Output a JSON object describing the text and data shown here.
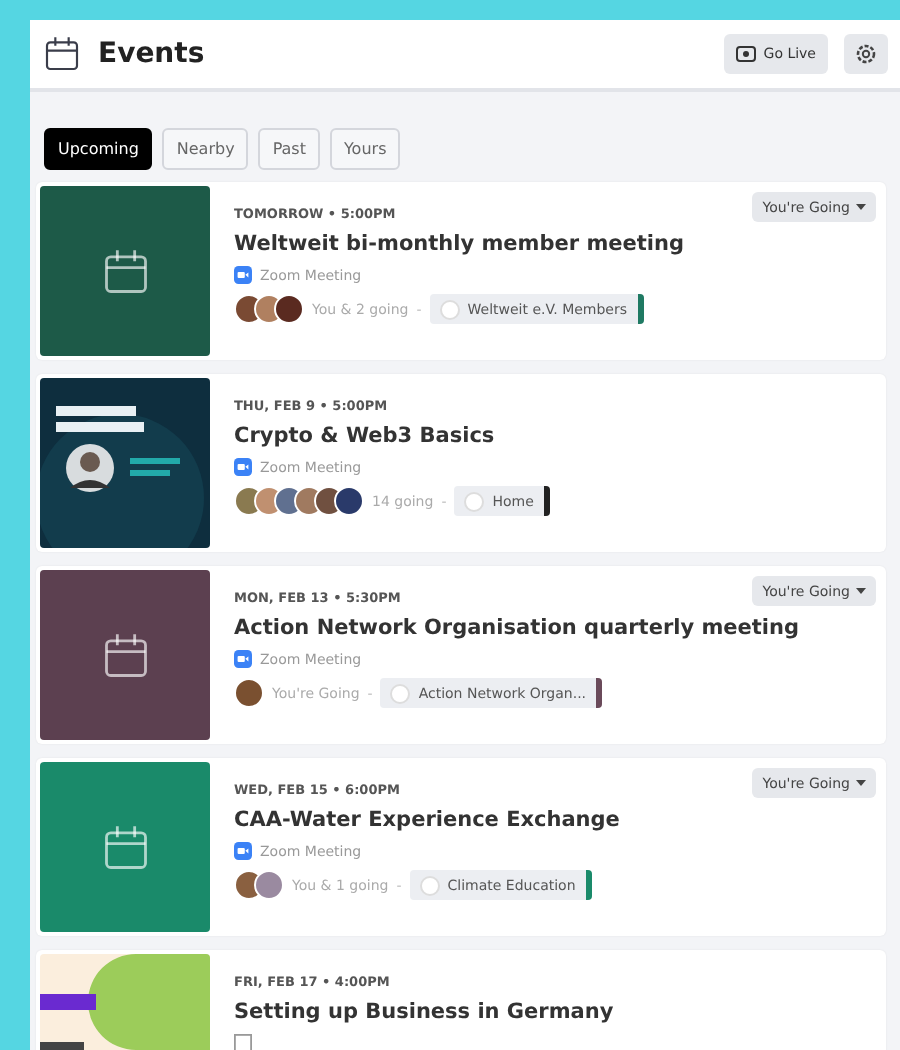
{
  "header": {
    "title": "Events",
    "go_live": "Go Live"
  },
  "tabs": [
    {
      "label": "Upcoming",
      "selected": true
    },
    {
      "label": "Nearby",
      "selected": false
    },
    {
      "label": "Past",
      "selected": false
    },
    {
      "label": "Yours",
      "selected": false
    }
  ],
  "events": [
    {
      "thumb": {
        "kind": "placeholder",
        "color": "#1d5a48"
      },
      "when": "TOMORROW • 5:00PM",
      "title": "Weltweit bi-monthly member meeting",
      "location": {
        "kind": "zoom",
        "label": "Zoom Meeting"
      },
      "rsvp": "You're Going",
      "avatars": [
        {
          "color": "#7a4a33"
        },
        {
          "color": "#b08060"
        },
        {
          "color": "#5a2a20"
        }
      ],
      "attendance": "You & 2 going",
      "separator": "-",
      "group": {
        "label": "Weltweit e.V. Members",
        "color": "#1f7a63"
      }
    },
    {
      "when": "THU, FEB 9 • 5:00PM",
      "title": "Crypto & Web3 Basics",
      "location": {
        "kind": "zoom",
        "label": "Zoom Meeting"
      },
      "avatars": [
        {
          "color": "#8a7a50"
        },
        {
          "color": "#c09070"
        },
        {
          "color": "#607090"
        },
        {
          "color": "#a07a60"
        },
        {
          "color": "#705040"
        },
        {
          "color": "#2a3a6a"
        }
      ],
      "attendance": "14 going",
      "separator": "-",
      "group": {
        "label": "Home",
        "color": "#222222"
      }
    },
    {
      "thumb": {
        "kind": "placeholder",
        "color": "#5c4050"
      },
      "when": "MON, FEB 13 • 5:30PM",
      "title": "Action Network Organisation quarterly meeting",
      "location": {
        "kind": "zoom",
        "label": "Zoom Meeting"
      },
      "rsvp": "You're Going",
      "avatars": [
        {
          "color": "#7a5030"
        }
      ],
      "attendance": "You're Going",
      "separator": "-",
      "group": {
        "label": "Action Network Organ...",
        "color": "#6a4a5a"
      }
    },
    {
      "thumb": {
        "kind": "placeholder",
        "color": "#1a8a6a"
      },
      "when": "WED, FEB 15 • 6:00PM",
      "title": "CAA-Water Experience Exchange",
      "location": {
        "kind": "zoom",
        "label": "Zoom Meeting"
      },
      "rsvp": "You're Going",
      "avatars": [
        {
          "color": "#8a6040"
        },
        {
          "color": "#9a8aa0"
        }
      ],
      "attendance": "You & 1 going",
      "separator": "-",
      "group": {
        "label": "Climate Education",
        "color": "#1a8a6a"
      }
    },
    {
      "when": "FRI, FEB 17 • 4:00PM",
      "title": "Setting up Business in Germany",
      "location": {
        "kind": "webinar"
      }
    }
  ]
}
